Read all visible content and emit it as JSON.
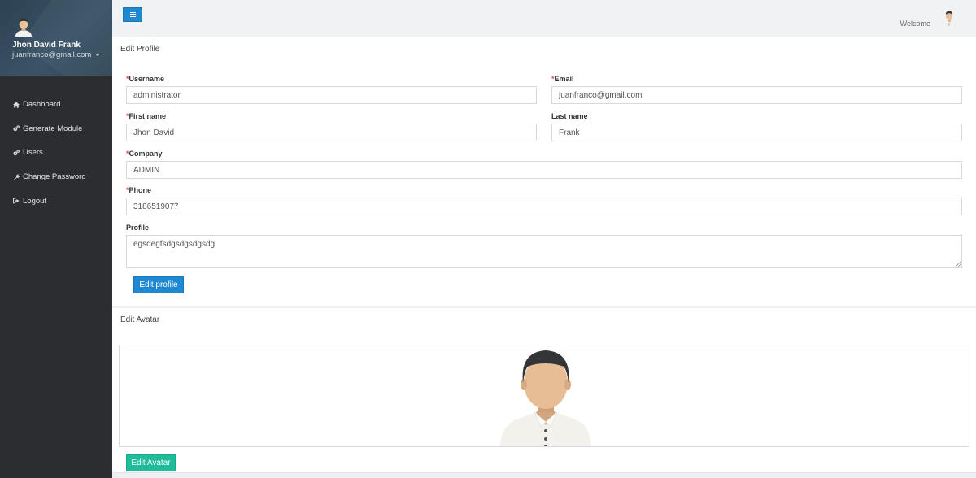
{
  "user": {
    "name": "Jhon David Frank",
    "email": "juanfranco@gmail.com"
  },
  "sidebar": {
    "items": [
      {
        "label": "Dashboard",
        "icon": "home-icon"
      },
      {
        "label": "Generate Module",
        "icon": "gears-icon"
      },
      {
        "label": "Users",
        "icon": "gears-icon"
      },
      {
        "label": "Change Password",
        "icon": "wrench-icon"
      },
      {
        "label": "Logout",
        "icon": "sign-out-icon"
      }
    ]
  },
  "topbar": {
    "welcome": "Welcome"
  },
  "profile_form": {
    "title": "Edit Profile",
    "username": {
      "label": "Username",
      "required_mark": "*",
      "value": "administrator"
    },
    "email": {
      "label": "Email",
      "required_mark": "*",
      "value": "juanfranco@gmail.com"
    },
    "first_name": {
      "label": "First name",
      "required_mark": "*",
      "value": "Jhon David"
    },
    "last_name": {
      "label": "Last name",
      "value": "Frank"
    },
    "company": {
      "label": "Company",
      "required_mark": "*",
      "value": "ADMIN"
    },
    "phone": {
      "label": "Phone",
      "required_mark": "*",
      "value": "3186519077"
    },
    "profile": {
      "label": "Profile",
      "value": "egsdegfsdgsdgsdgsdg"
    },
    "submit_label": "Edit profile"
  },
  "avatar_form": {
    "title": "Edit Avatar",
    "submit_label": "Edit Avatar"
  },
  "colors": {
    "primary": "#1e88d0",
    "success": "#1fbc9c",
    "sidebar": "#2b2d30",
    "required": "#d9534f"
  }
}
